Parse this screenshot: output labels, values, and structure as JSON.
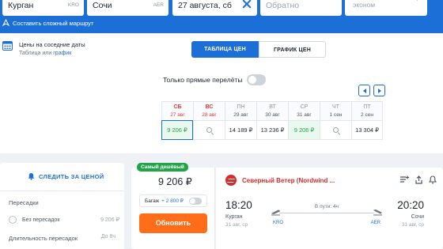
{
  "search": {
    "from_city": "Курган",
    "from_code": "KRO",
    "to_city": "Сочи",
    "to_code": "AER",
    "depart_date": "27 августа, сб",
    "return_placeholder": "Обратно",
    "passengers_sub": "эконом",
    "complex_route": "Составить сложный маршрут"
  },
  "calendar": {
    "nearby_title": "Цены на соседние даты",
    "nearby_sub_prefix": "Таблица или",
    "nearby_sub_link": "график",
    "tab_table": "ТАБЛИЦА ЦЕН",
    "tab_chart": "ГРАФИК ЦЕН",
    "direct_only": "Только прямые перелёты",
    "days": [
      {
        "dow": "СБ",
        "date": "27 авг",
        "price": "9 206 ₽",
        "kind": "weekend",
        "state": "selected"
      },
      {
        "dow": "ВС",
        "date": "28 авг",
        "price": "",
        "kind": "weekend",
        "state": "search"
      },
      {
        "dow": "ПН",
        "date": "29 авг",
        "price": "14 189 ₽",
        "kind": "weekday",
        "state": ""
      },
      {
        "dow": "ВТ",
        "date": "30 авг",
        "price": "13 236 ₽",
        "kind": "weekday",
        "state": ""
      },
      {
        "dow": "СР",
        "date": "31 авг",
        "price": "9 206 ₽",
        "kind": "weekday",
        "state": "cheap"
      },
      {
        "dow": "ЧТ",
        "date": "1 сен",
        "price": "",
        "kind": "weekday",
        "state": "search"
      },
      {
        "dow": "ПТ",
        "date": "2 сен",
        "price": "13 304 ₽",
        "kind": "weekday",
        "state": ""
      }
    ]
  },
  "sidebar": {
    "subscribe": "СЛЕДИТЬ ЗА ЦЕНОЙ",
    "transfers_title": "Пересадки",
    "no_transfers": "Без пересадок",
    "no_transfers_price": "9 206 ₽",
    "duration_title": "Длительность пересадок",
    "duration_value": "До 8ч"
  },
  "ticket": {
    "badge": "Самый дешёвый",
    "price": "9 206 ₽",
    "baggage_label": "Багаж",
    "baggage_price": "+ 2 800 ₽",
    "buy_button": "Обновить",
    "airline": "Северный Ветер (Nordwind ...",
    "dep_time": "18:20",
    "arr_time": "20:20",
    "dep_city": "Курган",
    "arr_city": "Сочи",
    "dep_date": "31 авг, ср",
    "arr_date": "31 авг, ср",
    "duration": "В пути: 4ч",
    "dep_code": "KRO",
    "arr_code": "AER"
  },
  "colors": {
    "accent": "#1d6fd8",
    "buy": "#ff6d18",
    "cheap": "#22a34a",
    "weekend": "#e03a3a",
    "airline": "#d32c2c"
  }
}
